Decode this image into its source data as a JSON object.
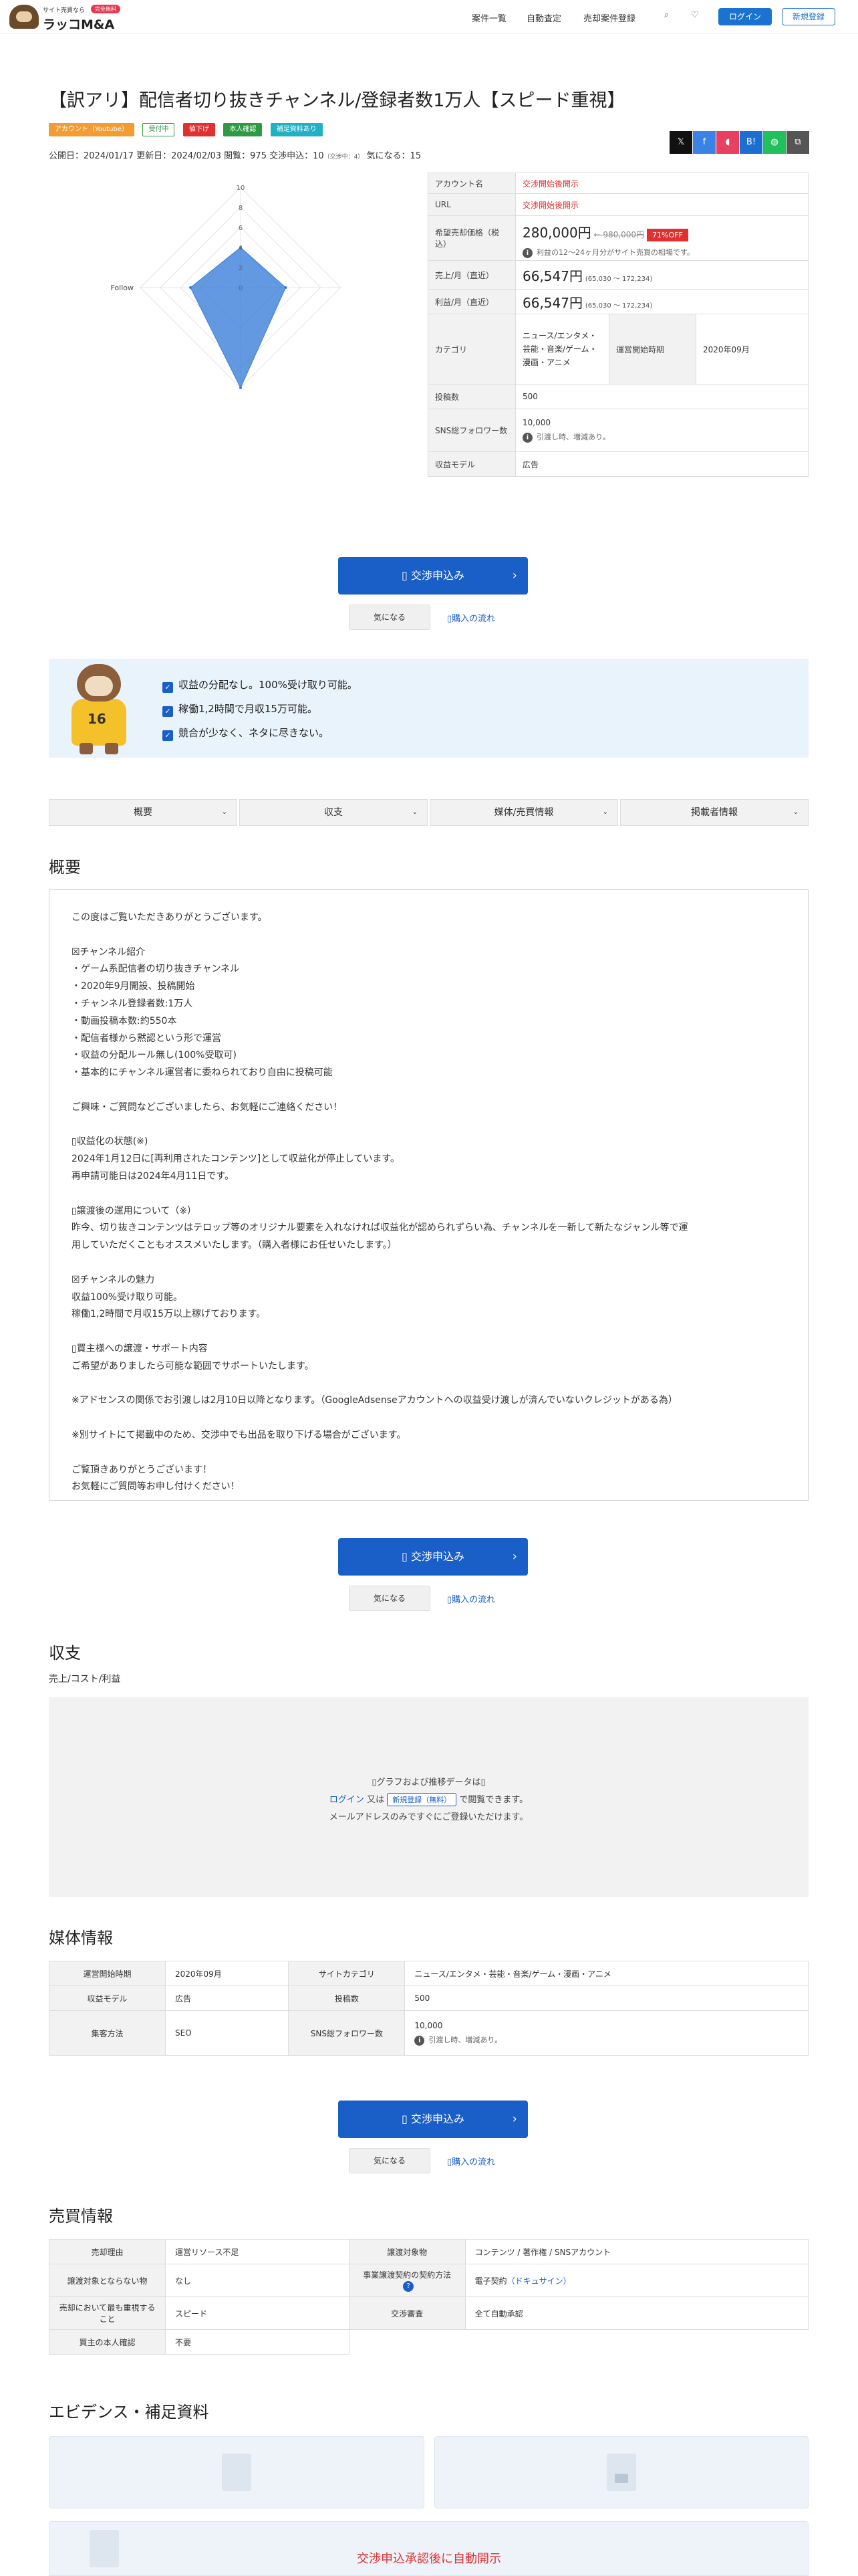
{
  "header": {
    "logo_small": "サイト売買なら",
    "logo_badge": "完全無料",
    "logo_main": "ラッコM&A",
    "nav": [
      "案件一覧",
      "自動査定",
      "売却案件登録"
    ],
    "icons": [
      "search-icon",
      "heart-icon"
    ],
    "login": "ログイン",
    "register": "新規登録"
  },
  "listing": {
    "title": "【訳アリ】配信者切り抜きチャンネル/登録者数1万人【スピード重視】",
    "tags": [
      {
        "label": "アカウント（Youtube）",
        "color": "#f39c32"
      },
      {
        "label": "受付中",
        "color": "#2e9b44"
      },
      {
        "label": "値下げ",
        "color": "#e03030"
      },
      {
        "label": "本人確認",
        "color": "#2e9b44"
      },
      {
        "label": "補足資料あり",
        "color": "#22b0c4"
      }
    ],
    "meta": {
      "published": "公開日：2024/01/17",
      "updated": "更新日：2024/02/03",
      "views": "閲覧：975",
      "negotiations": "交渉申込：10",
      "negotiating": "（交渉中：4）",
      "interested": "気になる：15"
    },
    "share_icons": [
      "x-icon",
      "facebook-icon",
      "pocket-icon",
      "hatena-icon",
      "line-icon",
      "copy-icon"
    ],
    "share_colors": [
      "#111111",
      "#3b82e6",
      "#e84060",
      "#1a6fd0",
      "#22c05a",
      "#555555"
    ]
  },
  "radar": {
    "axes": [
      "",
      "",
      "",
      "Follow"
    ],
    "ticks": [
      "10",
      "8",
      "6",
      "4",
      "2",
      "0"
    ],
    "values": [
      4,
      4.5,
      10,
      5
    ],
    "max": 10,
    "fill": "#3b7fd8"
  },
  "spec": {
    "account_name_label": "アカウント名",
    "account_name": "交渉開始後開示",
    "url_label": "URL",
    "url": "交渉開始後開示",
    "price_label": "希望売却価格（税込）",
    "price": "280,000円",
    "old_price": "← 980,000円",
    "discount": "71%OFF",
    "price_note": "利益の12〜24ヶ月分がサイト売買の相場です。",
    "sales_label": "売上/月（直近）",
    "sales": "66,547円",
    "sales_range": "(65,030 〜 172,234)",
    "profit_label": "利益/月（直近）",
    "profit": "66,547円",
    "profit_range": "(65,030 〜 172,234)",
    "category_label": "カテゴリ",
    "category": "ニュース/エンタメ・芸能・音楽/ゲーム・漫画・アニメ",
    "start_label": "運営開始時期",
    "start": "2020年09月",
    "posts_label": "投稿数",
    "posts": "500",
    "sns_label": "SNS総フォロワー数",
    "sns": "10,000",
    "sns_note": "引渡し時、増減あり。",
    "model_label": "収益モデル",
    "model": "広告"
  },
  "cta": {
    "label": "交渉申込み",
    "interest": "気になる",
    "flow": "購入の流れ"
  },
  "appeal": {
    "mascot_number": "16",
    "points": [
      "収益の分配なし。100%受け取り可能。",
      "稼働1,2時間で月収15万可能。",
      "競合が少なく、ネタに尽きない。"
    ]
  },
  "tabs": [
    "概要",
    "収支",
    "媒体/売買情報",
    "掲載者情報"
  ],
  "overview": {
    "heading": "概要",
    "lines": [
      "この度はご覧いただきありがとうございます。",
      "",
      "☒チャンネル紹介",
      "・ゲーム系配信者の切り抜きチャンネル",
      "・2020年9月開設、投稿開始",
      "・チャンネル登録者数:1万人",
      "・動画投稿本数:約550本",
      "・配信者様から黙認という形で運営",
      "・収益の分配ルール無し(100%受取可)",
      "・基本的にチャンネル運営者に委ねられており自由に投稿可能",
      "",
      "ご興味・ご質問などございましたら、お気軽にご連絡ください！",
      "",
      "▯収益化の状態(※)",
      "2024年1月12日に[再利用されたコンテンツ]として収益化が停止しています。",
      "再申請可能日は2024年4月11日です。",
      "",
      "▯譲渡後の運用について（※）",
      "昨今、切り抜きコンテンツはテロップ等のオリジナル要素を入れなければ収益化が認められずらい為、チャンネルを一新して新たなジャンル等で運",
      "用していただくこともオススメいたします。（購入者様にお任せいたします。）",
      "",
      "☒チャンネルの魅力",
      "収益100%受け取り可能。",
      "稼働1,2時間で月収15万以上稼げております。",
      "",
      "▯買主様への譲渡・サポート内容",
      "ご希望がありましたら可能な範囲でサポートいたします。",
      "",
      "※アドセンスの関係でお引渡しは2月10日以降となります。（GoogleAdsenseアカウントへの収益受け渡しが済んでいないクレジットがある為）",
      "",
      "※別サイトにて掲載中のため、交渉中でも出品を取り下げる場合がございます。",
      "",
      "ご覧頂きありがとうございます！",
      "お気軽にご質問等お申し付けください！"
    ]
  },
  "finance": {
    "heading": "収支",
    "sub": "売上/コスト/利益",
    "lock_line1": "▯グラフおよび推移データは▯",
    "login_link": "ログイン",
    "or": "又は",
    "register_btn": "新規登録（無料）",
    "lock_line2_tail": "で閲覧できます。",
    "lock_line3": "メールアドレスのみですぐにご登録いただけます。"
  },
  "media": {
    "heading": "媒体情報",
    "rows": [
      [
        "運営開始時期",
        "2020年09月",
        "サイトカテゴリ",
        "ニュース/エンタメ・芸能・音楽/ゲーム・漫画・アニメ"
      ],
      [
        "収益モデル",
        "広告",
        "投稿数",
        "500"
      ],
      [
        "集客方法",
        "SEO",
        "SNS総フォロワー数",
        "10,000"
      ]
    ],
    "sns_note": "引渡し時、増減あり。"
  },
  "trade": {
    "heading": "売買情報",
    "rows": [
      [
        "売却理由",
        "運営リソース不足",
        "譲渡対象物",
        "コンテンツ / 著作権 / SNSアカウント"
      ],
      [
        "譲渡対象とならない物",
        "なし",
        "事業譲渡契約の契約方法",
        "電子契約"
      ],
      [
        "売却において最も重視すること",
        "スピード",
        "交渉審査",
        "全て自動承認"
      ],
      [
        "買主の本人確認",
        "不要",
        "",
        ""
      ]
    ],
    "docusign": "（ドキュサイン）"
  },
  "evidence": {
    "heading": "エビデンス・補足資料",
    "note": "交渉申込承認後に自動開示"
  }
}
